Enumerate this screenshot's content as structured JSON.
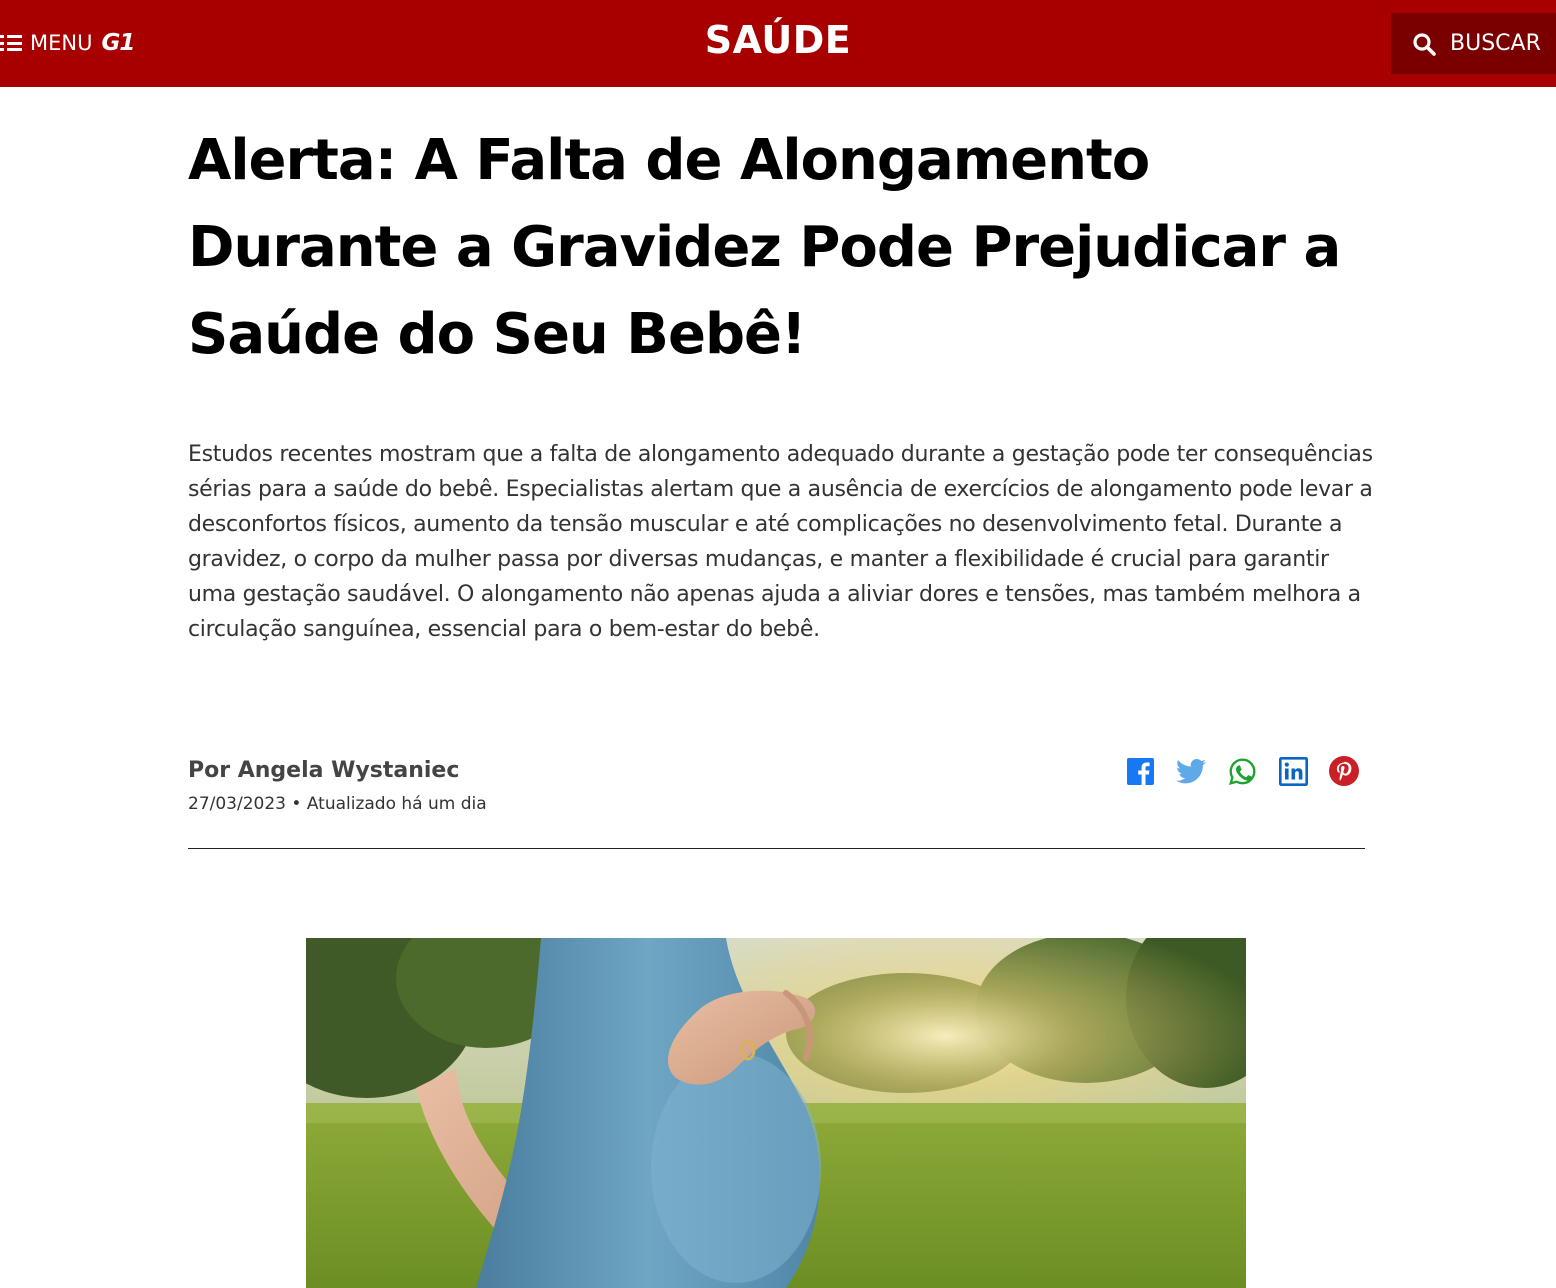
{
  "header": {
    "menu_label": "MENU",
    "logo_text": "G1",
    "section_title": "SAÚDE",
    "search_label": "BUSCAR"
  },
  "article": {
    "headline": "Alerta: A Falta de Alongamento Durante a Gravidez Pode Prejudicar a Saúde do Seu Bebê!",
    "lede": "Estudos recentes mostram que a falta de alongamento adequado durante a gestação pode ter consequências sérias para a saúde do bebê. Especialistas alertam que a ausência de exercícios de alongamento pode levar a desconfortos físicos, aumento da tensão muscular e até complicações no desenvolvimento fetal. Durante a gravidez, o corpo da mulher passa por diversas mudanças, e manter a flexibilidade é crucial para garantir uma gestação saudável. O alongamento não apenas ajuda a aliviar dores e tensões, mas também melhora a circulação sanguínea, essencial para o bem-estar do bebê.",
    "byline": "Por Angela Wystaniec",
    "dateline": "27/03/2023 • Atualizado há um dia"
  },
  "share": {
    "icons": [
      "facebook-icon",
      "twitter-icon",
      "whatsapp-icon",
      "linkedin-icon",
      "pinterest-icon"
    ]
  },
  "colors": {
    "brand_red": "#a80000",
    "search_bg": "#7a0000",
    "facebook": "#1877f2",
    "twitter": "#5fa9e8",
    "whatsapp": "#1fa32f",
    "linkedin": "#0a66c2",
    "pinterest": "#cb1f27"
  }
}
